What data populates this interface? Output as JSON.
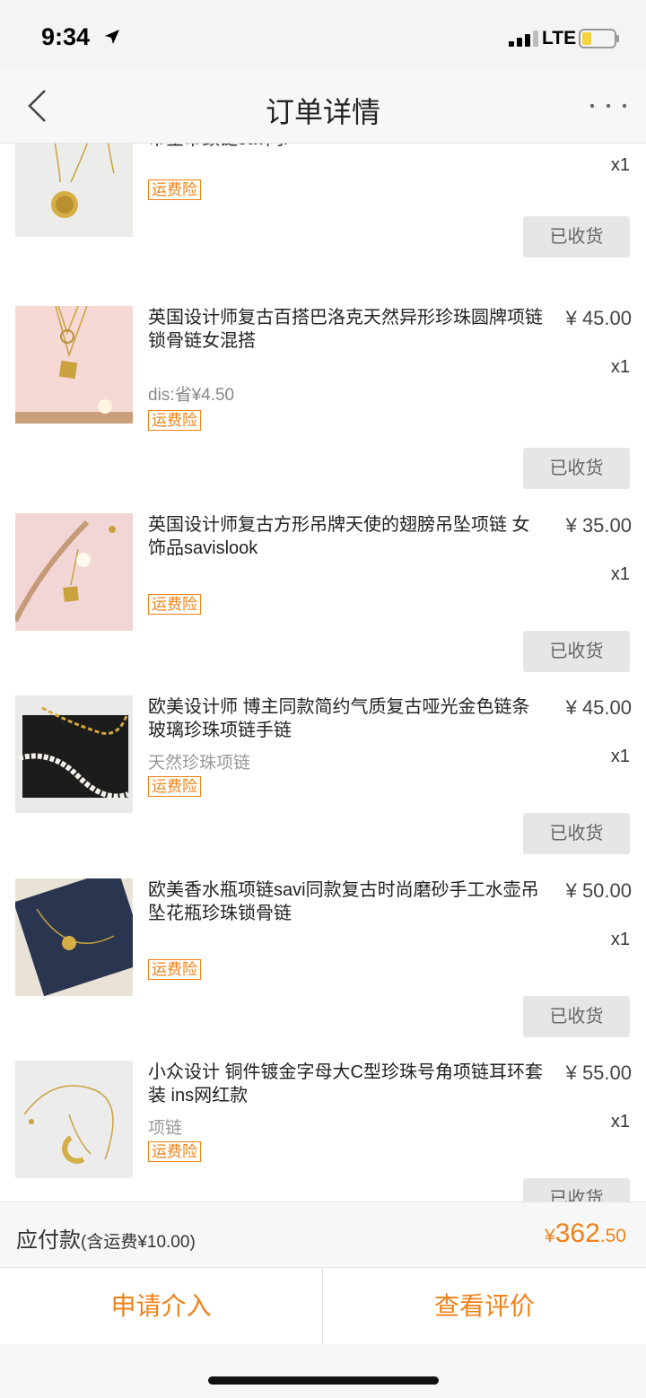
{
  "status_bar": {
    "time": "9:34",
    "network": "LTE"
  },
  "nav": {
    "title": "订单详情",
    "back_icon": "chevron-left-icon",
    "more_icon": "more-dots-icon"
  },
  "items": [
    {
      "title": "币金币颈链sav同i",
      "price": "",
      "qty": "x1",
      "sku": "",
      "tag": "运费险",
      "status": "已收货"
    },
    {
      "title": "英国设计师复古百搭巴洛克天然异形珍珠圆牌项链 锁骨链女混搭",
      "price": "¥ 45.00",
      "qty": "x1",
      "sku": "dis:省¥4.50",
      "tag": "运费险",
      "status": "已收货"
    },
    {
      "title": "英国设计师复古方形吊牌天使的翅膀吊坠项链 女饰品savislook",
      "price": "¥ 35.00",
      "qty": "x1",
      "sku": "",
      "tag": "运费险",
      "status": "已收货"
    },
    {
      "title": "欧美设计师 博主同款简约气质复古哑光金色链条玻璃珍珠项链手链",
      "price": "¥ 45.00",
      "qty": "x1",
      "sku": "天然珍珠项链",
      "tag": "运费险",
      "status": "已收货"
    },
    {
      "title": "欧美香水瓶项链savi同款复古时尚磨砂手工水壶吊坠花瓶珍珠锁骨链",
      "price": "¥ 50.00",
      "qty": "x1",
      "sku": "",
      "tag": "运费险",
      "status": "已收货"
    },
    {
      "title": "小众设计 铜件镀金字母大C型珍珠号角项链耳环套装 ins网红款",
      "price": "¥ 55.00",
      "qty": "x1",
      "sku": "项链",
      "tag": "运费险",
      "status": "已收货"
    }
  ],
  "summary": {
    "label": "应付款",
    "sub": "(含运费¥10.00)",
    "currency": "¥",
    "amount_int": "362",
    "amount_dec": ".50"
  },
  "actions": {
    "left": "申请介入",
    "right": "查看评价"
  },
  "colors": {
    "accent": "#f08219",
    "button_gray": "#e6e6e6"
  }
}
